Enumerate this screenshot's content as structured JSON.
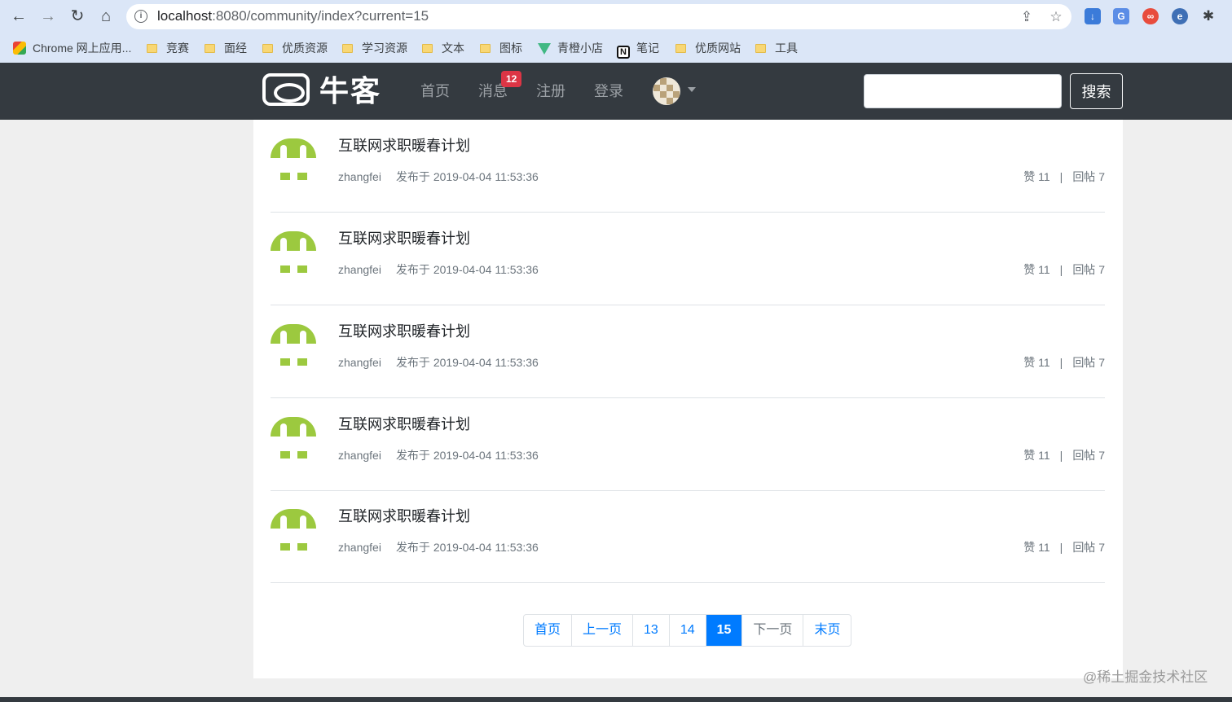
{
  "browser": {
    "url_host": "localhost",
    "url_rest": ":8080/community/index?current=15",
    "bookmarks": [
      "Chrome 网上应用...",
      "竞赛",
      "面经",
      "优质资源",
      "学习资源",
      "文本",
      "图标",
      "青橙小店",
      "笔记",
      "优质网站",
      "工具"
    ]
  },
  "header": {
    "logo_text": "牛客",
    "nav": {
      "home": "首页",
      "messages": "消息",
      "register": "注册",
      "login": "登录"
    },
    "message_badge": "12",
    "search_button": "搜索",
    "search_value": ""
  },
  "posts": [
    {
      "title": "互联网求职暖春计划",
      "author": "zhangfei",
      "time": "发布于 2019-04-04 11:53:36",
      "likes": "赞 11",
      "replies": "回帖 7"
    },
    {
      "title": "互联网求职暖春计划",
      "author": "zhangfei",
      "time": "发布于 2019-04-04 11:53:36",
      "likes": "赞 11",
      "replies": "回帖 7"
    },
    {
      "title": "互联网求职暖春计划",
      "author": "zhangfei",
      "time": "发布于 2019-04-04 11:53:36",
      "likes": "赞 11",
      "replies": "回帖 7"
    },
    {
      "title": "互联网求职暖春计划",
      "author": "zhangfei",
      "time": "发布于 2019-04-04 11:53:36",
      "likes": "赞 11",
      "replies": "回帖 7"
    },
    {
      "title": "互联网求职暖春计划",
      "author": "zhangfei",
      "time": "发布于 2019-04-04 11:53:36",
      "likes": "赞 11",
      "replies": "回帖 7"
    }
  ],
  "pagination": {
    "first": "首页",
    "prev": "上一页",
    "pages": [
      "13",
      "14",
      "15"
    ],
    "current": "15",
    "next": "下一页",
    "last": "末页"
  },
  "watermark": "@稀土掘金技术社区",
  "colors": {
    "header_bg": "#343a40",
    "accent": "#007bff",
    "badge": "#dc3545",
    "avatar": "#9cc93f"
  }
}
